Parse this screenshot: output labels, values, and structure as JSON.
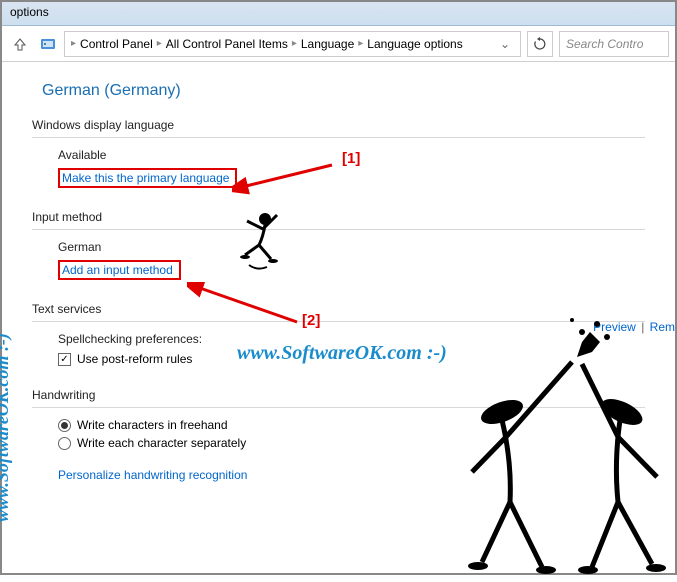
{
  "window": {
    "title": "options"
  },
  "breadcrumb": {
    "items": [
      "Control Panel",
      "All Control Panel Items",
      "Language",
      "Language options"
    ]
  },
  "search": {
    "placeholder": "Search Contro"
  },
  "page": {
    "title": "German (Germany)"
  },
  "sections": {
    "display": {
      "header": "Windows display language",
      "status": "Available",
      "primary_link": "Make this the primary language"
    },
    "input": {
      "header": "Input method",
      "language": "German",
      "add_link": "Add an input method",
      "preview": "Preview",
      "remove": "Rem"
    },
    "text_services": {
      "header": "Text services",
      "spell_label": "Spellchecking preferences:",
      "post_reform": "Use post-reform rules"
    },
    "handwriting": {
      "header": "Handwriting",
      "freehand": "Write characters in freehand",
      "separate": "Write each character separately",
      "personalize": "Personalize handwriting recognition"
    }
  },
  "annotations": {
    "label1": "[1]",
    "label2": "[2]",
    "watermark": "www.SoftwareOK.com :-)"
  }
}
